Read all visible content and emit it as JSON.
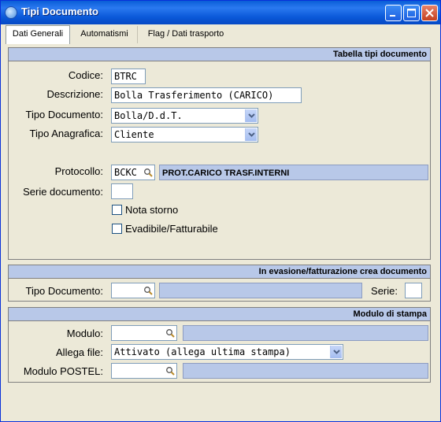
{
  "window": {
    "title": "Tipi Documento"
  },
  "tabs": [
    {
      "label": "Dati Generali"
    },
    {
      "label": "Automatismi"
    },
    {
      "label": "Flag / Dati trasporto"
    }
  ],
  "section1": {
    "header": "Tabella tipi documento",
    "codice_label": "Codice:",
    "codice_value": "BTRC",
    "descrizione_label": "Descrizione:",
    "descrizione_value": "Bolla Trasferimento (CARICO)",
    "tipo_documento_label": "Tipo Documento:",
    "tipo_documento_value": "Bolla/D.d.T.",
    "tipo_anagrafica_label": "Tipo Anagrafica:",
    "tipo_anagrafica_value": "Cliente",
    "protocollo_label": "Protocollo:",
    "protocollo_code": "BCKC",
    "protocollo_desc": "PROT.CARICO TRASF.INTERNI",
    "serie_label": "Serie documento:",
    "serie_value": "",
    "nota_storno_label": "Nota storno",
    "evadibile_label": "Evadibile/Fatturabile"
  },
  "section2": {
    "header": "In evasione/fatturazione crea documento",
    "tipo_documento_label": "Tipo Documento:",
    "tipo_documento_value": "",
    "serie_label": "Serie:",
    "serie_value": ""
  },
  "section3": {
    "header": "Modulo di stampa",
    "modulo_label": "Modulo:",
    "modulo_value": "",
    "allega_label": "Allega file:",
    "allega_value": "Attivato (allega ultima stampa)",
    "postel_label": "Modulo POSTEL:",
    "postel_value": ""
  },
  "colors": {
    "titlebar": "#0a5ed7",
    "section_header": "#b8c8e8",
    "background": "#ece9d8"
  }
}
